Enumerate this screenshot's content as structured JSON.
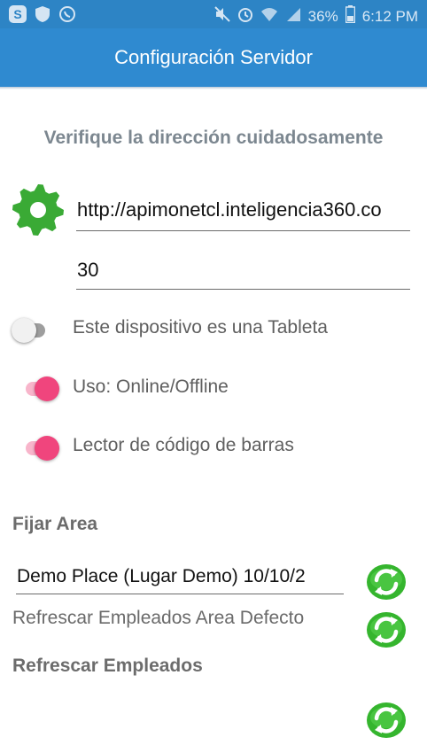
{
  "status_bar": {
    "left_icons": [
      "skype-icon",
      "shield-icon",
      "whatsapp-icon"
    ],
    "right_icons": [
      "mute-icon",
      "alarm-icon",
      "wifi-icon",
      "signal-icon"
    ],
    "battery": "36%",
    "battery_icon": "battery-icon",
    "time": "6:12 PM"
  },
  "app_bar": {
    "title": "Configuración Servidor"
  },
  "main": {
    "heading": "Verifique la dirección cuidadosamente",
    "settings_icon": "gear-icon",
    "url": {
      "value": "http://apimonetcl.inteligencia360.co"
    },
    "number": {
      "value": "30"
    },
    "switches": [
      {
        "label": "Este dispositivo es una Tableta",
        "state": "off"
      },
      {
        "label": "Uso: Online/Offline",
        "state": "on"
      },
      {
        "label": "Lector de código de barras",
        "state": "on"
      }
    ],
    "area_title": "Fijar Area",
    "area_value": "Demo Place (Lugar Demo) 10/10/2",
    "refresh_default": "Refrescar Empleados Area Defecto",
    "refresh_employees": "Refrescar Empleados",
    "refresh_icon": "refresh-icon"
  },
  "colors": {
    "status_bar": "#2d84c5",
    "app_bar": "#2f8ad0",
    "gear": "#3aaa35",
    "switch_on": "#f0457d",
    "switch_on_track": "#f8b5cb",
    "refresh_icon": "#35b52e"
  }
}
